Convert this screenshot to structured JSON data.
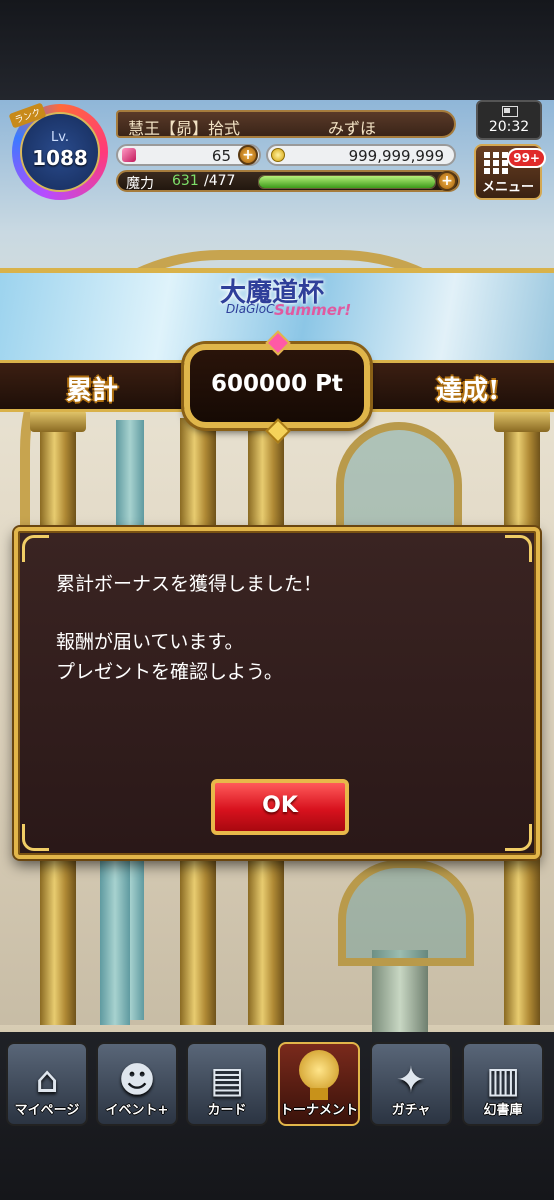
{
  "player": {
    "rank_tag": "ランク",
    "level_prefix": "Lv.",
    "level": "1088",
    "title": "慧王【昴】拾式",
    "name": "みずほ",
    "gems": "65",
    "coins": "999,999,999",
    "mp_label": "魔力",
    "mp_current": "631",
    "mp_max": "/477",
    "mp_fill_fraction": 1.0
  },
  "status": {
    "time": "20:32"
  },
  "menu": {
    "label": "メニュー",
    "badge": "99+"
  },
  "banner": {
    "event_title": "大魔道杯",
    "event_sub": "DIaGloC",
    "event_summer": "Summer!",
    "left_text": "累計",
    "points": "600000 Pt",
    "right_text": "達成!"
  },
  "dialog": {
    "line1": "累計ボーナスを獲得しました！",
    "line2": "報酬が届いています。",
    "line3": "プレゼントを確認しよう。",
    "ok_label": "OK"
  },
  "nav": {
    "items": [
      {
        "label": "マイページ",
        "icon": "house-icon"
      },
      {
        "label": "イベント+",
        "icon": "cat-icon"
      },
      {
        "label": "カード",
        "icon": "cards-icon"
      },
      {
        "label": "トーナメント",
        "icon": "trophy-icon"
      },
      {
        "label": "ガチャ",
        "icon": "gacha-icon"
      },
      {
        "label": "幻書庫",
        "icon": "library-icon"
      }
    ]
  },
  "colors": {
    "gold": "#e2b64a",
    "ok_red": "#d8121e",
    "mp_green": "#7ee06a"
  }
}
